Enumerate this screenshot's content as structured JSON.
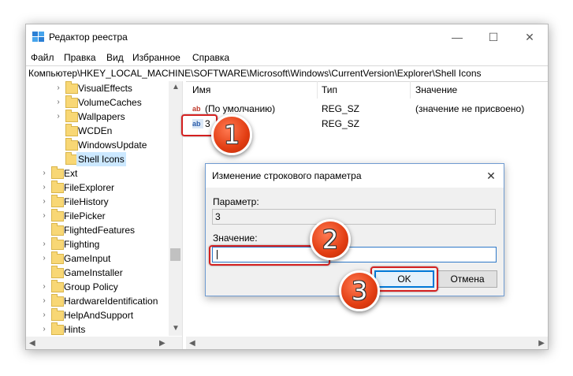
{
  "window": {
    "title": "Редактор реестра",
    "controls": {
      "minimize": "—",
      "maximize": "☐",
      "close": "✕"
    }
  },
  "menu": [
    "Файл",
    "Правка",
    "Вид",
    "Избранное",
    "Справка"
  ],
  "address": "Компьютер\\HKEY_LOCAL_MACHINE\\SOFTWARE\\Microsoft\\Windows\\CurrentVersion\\Explorer\\Shell Icons",
  "tree": [
    {
      "label": "VisualEffects",
      "expandable": true
    },
    {
      "label": "VolumeCaches",
      "expandable": true
    },
    {
      "label": "Wallpapers",
      "expandable": true
    },
    {
      "label": "WCDEn",
      "expandable": false
    },
    {
      "label": "WindowsUpdate",
      "expandable": false
    },
    {
      "label": "Shell Icons",
      "expandable": false,
      "selected": true
    },
    {
      "label": "Ext",
      "expandable": true
    },
    {
      "label": "FileExplorer",
      "expandable": true
    },
    {
      "label": "FileHistory",
      "expandable": true
    },
    {
      "label": "FilePicker",
      "expandable": true
    },
    {
      "label": "FlightedFeatures",
      "expandable": false
    },
    {
      "label": "Flighting",
      "expandable": true
    },
    {
      "label": "GameInput",
      "expandable": true
    },
    {
      "label": "GameInstaller",
      "expandable": false
    },
    {
      "label": "Group Policy",
      "expandable": true
    },
    {
      "label": "HardwareIdentification",
      "expandable": true
    },
    {
      "label": "HelpAndSupport",
      "expandable": true
    },
    {
      "label": "Hints",
      "expandable": true
    }
  ],
  "columns": {
    "name": "Имя",
    "type": "Тип",
    "value": "Значение"
  },
  "values": [
    {
      "name": "(По умолчанию)",
      "type": "REG_SZ",
      "data": "(значение не присвоено)"
    },
    {
      "name": "3",
      "type": "REG_SZ",
      "data": ""
    }
  ],
  "icon_text": "ab",
  "dialog": {
    "title": "Изменение строкового параметра",
    "param_label": "Параметр:",
    "param_value": "3",
    "value_label": "Значение:",
    "value_text": "",
    "ok": "OK",
    "cancel": "Отмена"
  },
  "callouts": [
    "1",
    "2",
    "3"
  ],
  "colors": {
    "highlight": "#d42020",
    "badge": "#e23d12",
    "selection": "#cce8ff",
    "accent": "#0078d7"
  }
}
